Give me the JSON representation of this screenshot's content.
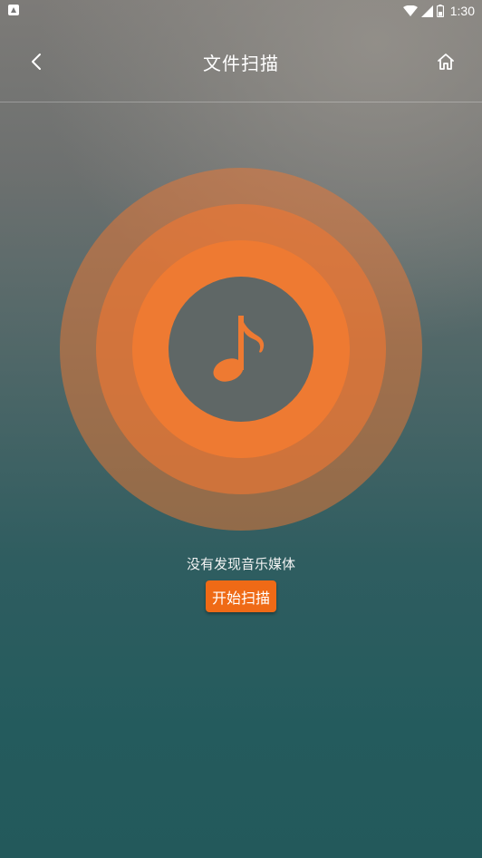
{
  "status_bar": {
    "time": "1:30",
    "icons": [
      "notification-icon",
      "wifi-icon",
      "signal-icon",
      "battery-icon"
    ]
  },
  "header": {
    "title": "文件扫描",
    "back_icon": "back-icon",
    "home_icon": "home-icon"
  },
  "main": {
    "center_icon": "music-note-icon",
    "empty_message": "没有发现音乐媒体",
    "scan_button_label": "开始扫描"
  },
  "colors": {
    "accent": "#ef6a16",
    "ring": "#ee7a32",
    "background_bottom": "#245b5d"
  }
}
